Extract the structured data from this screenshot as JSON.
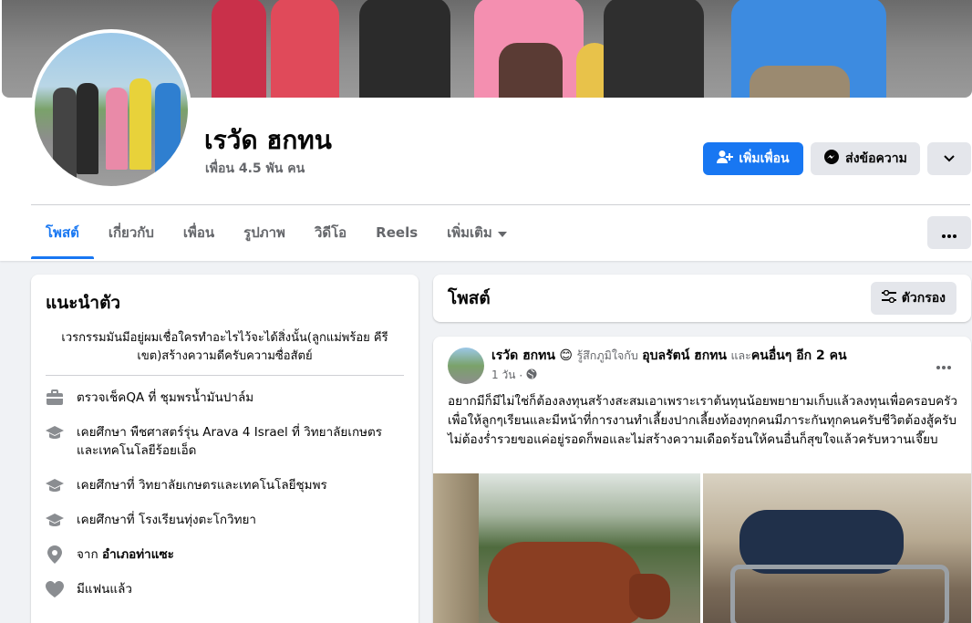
{
  "profile": {
    "name": "เรวัด ฮกทน",
    "friends": "เพื่อน 4.5 พัน คน"
  },
  "actions": {
    "add_friend": "เพิ่มเพื่อน",
    "message": "ส่งข้อความ"
  },
  "tabs": [
    {
      "label": "โพสต์"
    },
    {
      "label": "เกี่ยวกับ"
    },
    {
      "label": "เพื่อน"
    },
    {
      "label": "รูปภาพ"
    },
    {
      "label": "วิดีโอ"
    },
    {
      "label": "Reels"
    },
    {
      "label": "เพิ่มเติม"
    }
  ],
  "intro": {
    "title": "แนะนำตัว",
    "bio": "เวรกรรมมันมีอยู่ผมเชื่อใครทำอะไรไว้จะได้สิ่งนั้น(ลูกแม่พร้อย คีรีเขต)สร้างความดีครับความซื่อสัตย์",
    "items": [
      {
        "icon": "briefcase-icon",
        "text": "ตรวจเช็คQA ที่ ชุมพรน้ำมันปาล์ม"
      },
      {
        "icon": "graduation-cap-icon",
        "text": "เคยศึกษา พืชศาสตร์รุ่น Arava 4 Israel ที่ วิทยาลัยเกษตรและเทคโนโลยีร้อยเอ็ด"
      },
      {
        "icon": "graduation-cap-icon",
        "text": "เคยศึกษาที่ วิทยาลัยเกษตรและเทคโนโลยีชุมพร"
      },
      {
        "icon": "graduation-cap-icon",
        "text": "เคยศึกษาที่ โรงเรียนทุ่งตะโกวิทยา"
      },
      {
        "icon": "location-pin-icon",
        "prefix": "จาก ",
        "text": "อำเภอท่าแซะ"
      },
      {
        "icon": "heart-icon",
        "text": "มีแฟนแล้ว"
      }
    ]
  },
  "posts_header": {
    "title": "โพสต์",
    "filter": "ตัวกรอง"
  },
  "post": {
    "author": "เรวัด ฮกทน",
    "feeling": "รู้สึกภูมิใจกับ",
    "tagged": "อุบลรัตน์ ฮกทน",
    "and": "และ",
    "others": "คนอื่นๆ อีก 2 คน",
    "time": "1 วัน",
    "text": "อยากมีก็มีไม่ใช่ก็ต้องลงทุนสร้างสะสมเอาเพราะเราต้นทุนน้อยพยายามเก็บแล้วลงทุนเพื่อครอบครัวเพื่อให้ลูกๆเรียนและมีหน้าที่การงานทำเลี้ยงปากเลี้ยงท้องทุกคนมีภาระกันทุกคนครับชีวิตต้องสู้ครับไม่ต้องร่ำรวยขอแค่อยู่รอดก็พอและไม่สร้างความเดือดร้อนให้คนอื่นก็สุขใจแล้วครับหวานเจี๊ยบ"
  }
}
